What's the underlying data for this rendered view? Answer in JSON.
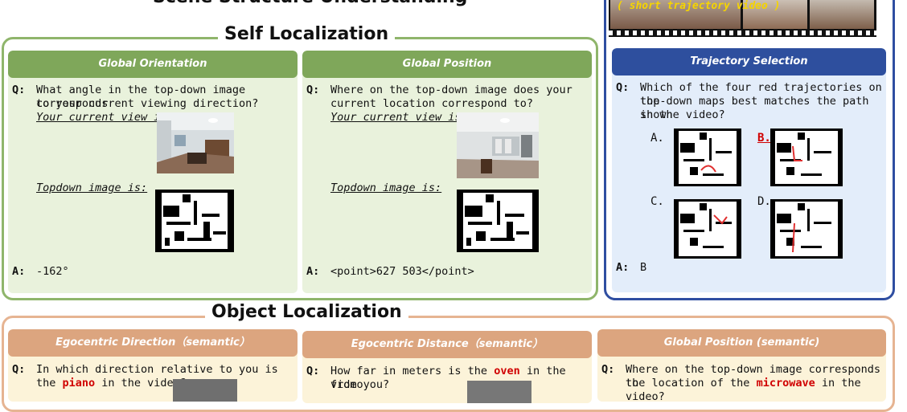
{
  "top_title": "Scene Structure Understanding",
  "video_caption": "( short trajectory video )",
  "self_localization": {
    "title": "Self Localization",
    "global_orientation": {
      "header": "Global Orientation",
      "q_label": "Q:",
      "question": [
        "What angle in the top-down image corresponds",
        "to your current viewing direction?"
      ],
      "view_label": "Your current view is:",
      "topdown_label": "Topdown image is:",
      "a_label": "A:",
      "answer": "-162°"
    },
    "global_position": {
      "header": "Global Position",
      "q_label": "Q:",
      "question": [
        "Where on the top-down image does your",
        "current location correspond to?"
      ],
      "view_label": "Your current view is:",
      "topdown_label": "Topdown image is:",
      "a_label": "A:",
      "answer": "<point>627 503</point>"
    }
  },
  "trajectory_selection": {
    "header": "Trajectory Selection",
    "q_label": "Q:",
    "question": [
      "Which of the four red trajectories on the",
      "top-down maps best matches the path shown",
      "in the video?"
    ],
    "options": [
      "A.",
      "B.",
      "C.",
      "D."
    ],
    "a_label": "A:",
    "answer": "B"
  },
  "object_localization": {
    "title": "Object Localization",
    "egocentric_direction": {
      "header": "Egocentric Direction（semantic）",
      "q_label": "Q:",
      "question_a": "In which direction relative to you is",
      "question_b1": "the ",
      "highlight": "piano",
      "question_b2": " in the video?"
    },
    "egocentric_distance": {
      "header": "Egocentric Distance（semantic）",
      "q_label": "Q:",
      "question_a1": "How far in meters is the ",
      "highlight": "oven",
      "question_a2": " in the video",
      "question_b": "from you?"
    },
    "global_position_semantic": {
      "header": "Global Position (semantic)",
      "q_label": "Q:",
      "question_a": "Where on the top-down image corresponds to",
      "question_b1": "the location of the ",
      "highlight": "microwave",
      "question_b2": " in the video?"
    }
  },
  "colors": {
    "green_border": "#8fb56b",
    "green_header": "#7fa75a",
    "green_panel": "#e9f2dc",
    "blue_border": "#2f4ea1",
    "blue_header": "#2e4f9e",
    "blue_panel": "#e3edfa",
    "orange_border": "#e6b492",
    "orange_header": "#dca57f",
    "orange_panel": "#fcf3d9",
    "highlight_red": "#d00000"
  }
}
